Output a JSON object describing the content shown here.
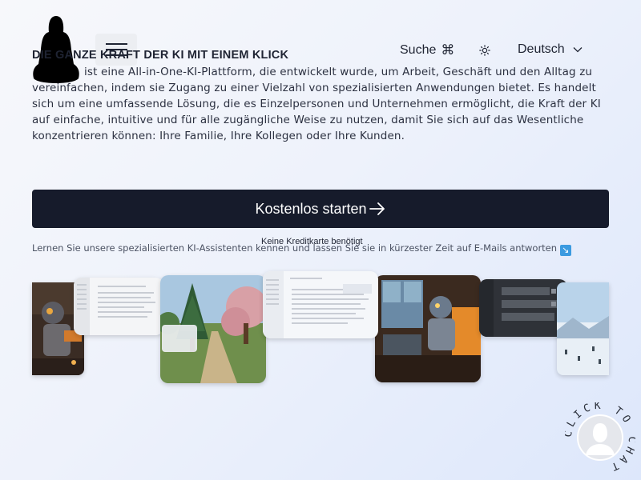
{
  "header": {
    "search_label": "Suche",
    "search_shortcut": "⌘",
    "language": "Deutsch"
  },
  "hero": {
    "heading": "DIE GANZE KRAFT DER KI MIT EINEM KLICK",
    "intro": "ist eine All-in-One-KI-Plattform, die entwickelt wurde, um Arbeit, Geschäft und den Alltag zu vereinfachen, indem sie Zugang zu einer Vielzahl von spezialisierten Anwendungen bietet. Es handelt sich um eine umfassende Lösung, die es Einzelpersonen und Unternehmen ermöglicht, die Kraft der KI auf einfache, intuitive und für alle zugängliche Weise zu nutzen, damit Sie sich auf das Wesentliche konzentrieren können: Ihre Familie, Ihre Kollegen oder Ihre Kunden.",
    "cta_label": "Kostenlos starten",
    "no_card_note": "Keine Kreditkarte benötigt",
    "learn_text": "Lernen Sie unsere spezialisierten KI-Assistenten kennen und lassen Sie sie in kürzester Zeit auf E-Mails antworten",
    "learn_icon": "↘"
  },
  "chat_badge": {
    "text": "CLICK TO CHAT"
  },
  "colors": {
    "cta_bg": "#161b2b",
    "accent_blue": "#3b9ae0"
  }
}
